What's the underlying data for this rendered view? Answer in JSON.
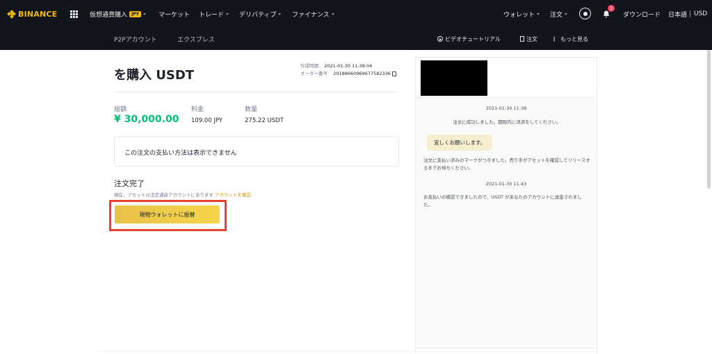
{
  "nav": {
    "logo": "BINANCE",
    "items": [
      {
        "label": "仮想通貨購入",
        "badge": "JPY"
      },
      {
        "label": "マーケット"
      },
      {
        "label": "トレード"
      },
      {
        "label": "デリバティブ"
      },
      {
        "label": "ファイナンス"
      }
    ],
    "wallet": "ウォレット",
    "orders": "注文",
    "notification_count": "3",
    "download": "ダウンロード",
    "language": "日本語",
    "currency": "USD"
  },
  "subnav": {
    "tabs": [
      "P2Pアカウント",
      "エクスプレス"
    ],
    "video_tutorial": "ビデオチュートリアル",
    "orders": "注文",
    "more": "もっと見る"
  },
  "order": {
    "title": "を購入 USDT",
    "created_label": "作成時間:",
    "created_value": "2021-01-30 11:38:04",
    "order_no_label": "オーダー番号:",
    "order_no_value": "20188660969677582336",
    "total_label": "総額",
    "total_value": "¥ 30,000.00",
    "price_label": "料金",
    "price_value": "109.00 JPY",
    "qty_label": "数量",
    "qty_value": "275.22 USDT",
    "payment_notice": "この注文の支払い方法は表示できません",
    "complete_title": "注文完了",
    "complete_sub": "現在、アセットは法定通貨アカウントにあります",
    "check_account_link": "アカウントを確認",
    "transfer_button": "現物ウォレットに振替"
  },
  "chat": {
    "timestamp1": "2021-01-30 11:38",
    "msg_order_success": "注文に成功しました。期限内に決済をしてください。",
    "bubble": "宜しくお願いします。",
    "msg_marked_paid": "注文に支払い済みのマークがつきました。売り手がアセットを確認してリリースするまでお待ちください。",
    "timestamp2": "2021-01-30 11:43",
    "msg_released": "お支払いの確認できましたので、USDT があなたのアカウントに送金されました。"
  },
  "colors": {
    "nav_bg": "#12161c",
    "brand_yellow": "#f0b90b",
    "total_green": "#02c076",
    "highlight_red": "#e8402a"
  }
}
